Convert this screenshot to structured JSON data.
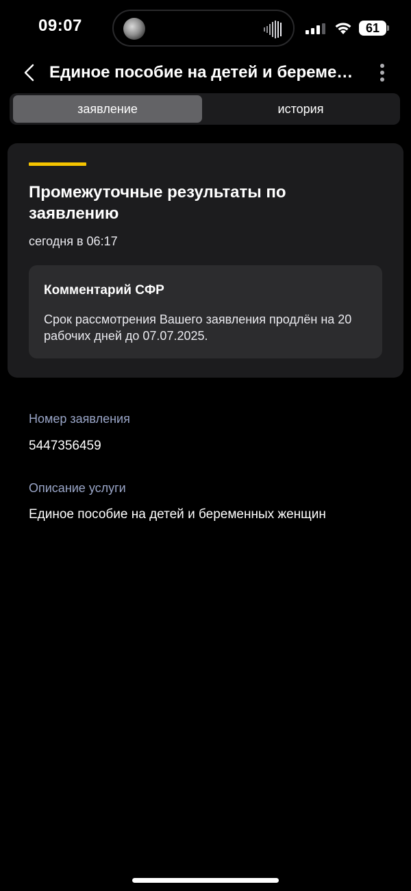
{
  "status_bar": {
    "time": "09:07",
    "battery": "61",
    "icons": [
      "signal-icon",
      "wifi-icon",
      "battery-icon",
      "audio-wave-icon"
    ]
  },
  "header": {
    "title": "Единое пособие на детей и беременных женщин",
    "back_icon": "chevron-left-icon",
    "more_icon": "more-vertical-icon"
  },
  "tabs": [
    {
      "label": "заявление",
      "active": true
    },
    {
      "label": "история",
      "active": false
    }
  ],
  "card": {
    "accent_color": "#f5c400",
    "title": "Промежуточные результаты по заявлению",
    "time": "сегодня в 06:17",
    "comment": {
      "title": "Комментарий СФР",
      "text": "Срок рассмотрения Вашего заявления продлён на 20 рабочих дней до 07.07.2025."
    }
  },
  "details": {
    "number_label": "Номер заявления",
    "number_value": "5447356459",
    "service_label": "Описание услуги",
    "service_value": "Единое пособие на детей и беременных женщин"
  }
}
